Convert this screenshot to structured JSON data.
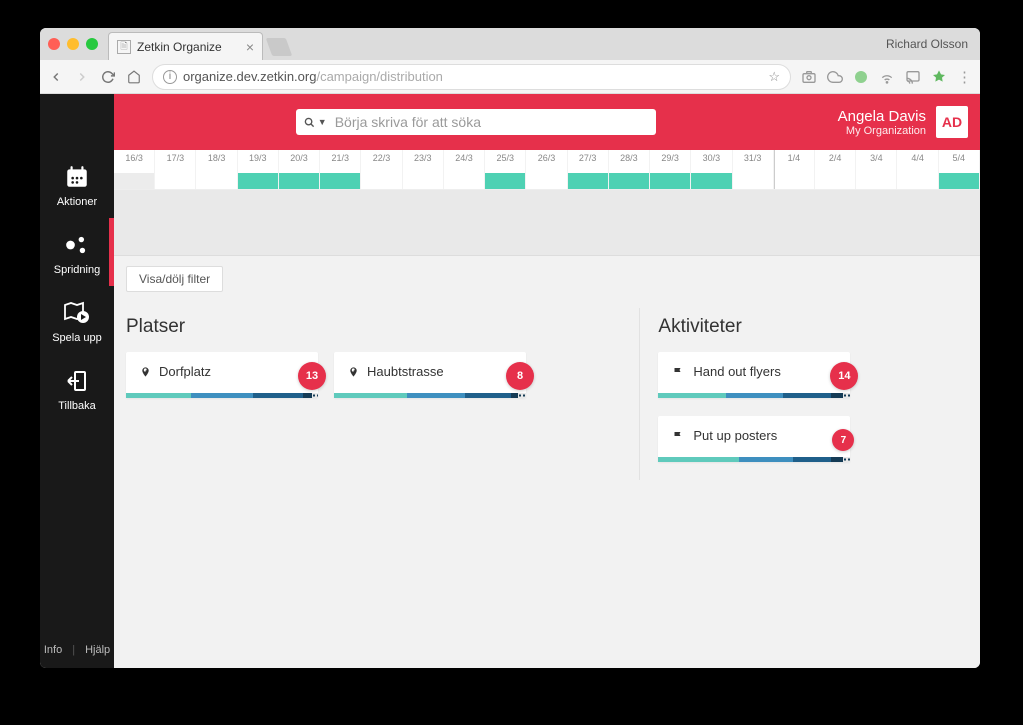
{
  "browser": {
    "tab_title": "Zetkin Organize",
    "profile_name": "Richard Olsson",
    "url_host": "organize.dev.zetkin.org",
    "url_path": "/campaign/distribution"
  },
  "header": {
    "search_placeholder": "Börja skriva för att söka",
    "user_name": "Angela Davis",
    "user_org": "My Organization",
    "user_initials": "AD"
  },
  "sidebar": {
    "items": [
      {
        "label": "Aktioner",
        "icon": "calendar"
      },
      {
        "label": "Spridning",
        "icon": "spread",
        "active": true
      },
      {
        "label": "Spela upp",
        "icon": "play"
      },
      {
        "label": "Tillbaka",
        "icon": "back"
      }
    ],
    "footer": {
      "info": "Info",
      "help": "Hjälp"
    }
  },
  "timeline": {
    "dates": [
      "16/3",
      "17/3",
      "18/3",
      "19/3",
      "20/3",
      "21/3",
      "22/3",
      "23/3",
      "24/3",
      "25/3",
      "26/3",
      "27/3",
      "28/3",
      "29/3",
      "30/3",
      "31/3",
      "1/4",
      "2/4",
      "3/4",
      "4/4",
      "5/4"
    ],
    "fills": [
      "grey",
      "none",
      "none",
      "teal",
      "teal",
      "teal",
      "none",
      "none",
      "none",
      "teal",
      "none",
      "teal",
      "teal",
      "teal",
      "teal",
      "none",
      "none",
      "none",
      "none",
      "none",
      "teal"
    ]
  },
  "toolbar": {
    "filter_label": "Visa/dölj filter"
  },
  "sections": {
    "places_title": "Platser",
    "activities_title": "Aktiviteter",
    "places": [
      {
        "name": "Dorfplatz",
        "count": 13
      },
      {
        "name": "Haubtstrasse",
        "count": 8
      }
    ],
    "activities": [
      {
        "name": "Hand out flyers",
        "count": 14
      },
      {
        "name": "Put up posters",
        "count": 7
      }
    ]
  }
}
